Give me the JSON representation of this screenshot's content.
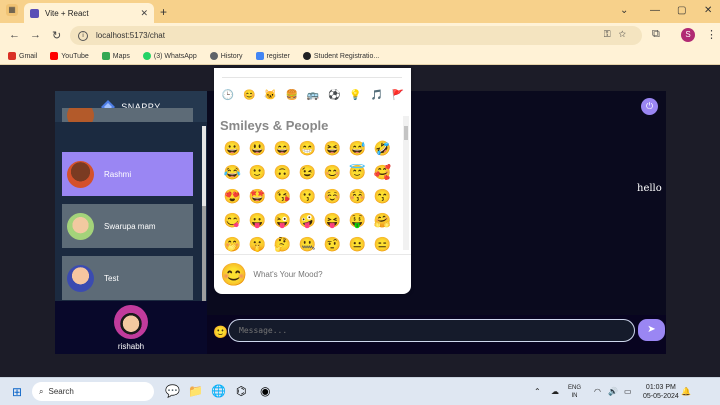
{
  "browser": {
    "tab_title": "Vite + React",
    "tab_close": "✕",
    "new_tab": "+",
    "window_controls": [
      "⌄",
      "—",
      "▢",
      "✕"
    ],
    "nav": {
      "back": "←",
      "forward": "→",
      "reload": "↻"
    },
    "url": "localhost:5173/chat",
    "omnibox_icons": "⚿☆",
    "profile_initial": "S",
    "bookmarks": [
      {
        "label": "Gmail",
        "color": "#d93025"
      },
      {
        "label": "YouTube",
        "color": "#ff0000"
      },
      {
        "label": "Maps",
        "color": "#34a853"
      },
      {
        "label": "(3) WhatsApp",
        "color": "#25d366"
      },
      {
        "label": "History",
        "color": "#5f6368"
      },
      {
        "label": "register",
        "color": "#4285f4"
      },
      {
        "label": "Student Registratio...",
        "color": "#202124"
      }
    ]
  },
  "app": {
    "brand": "SNAPPY",
    "accent": "#9a86f3",
    "contacts": [
      {
        "name": "Rashmi",
        "selected": true
      },
      {
        "name": "Swarupa mam",
        "selected": false
      },
      {
        "name": "Test",
        "selected": false
      }
    ],
    "current_user": "rishabh",
    "messages": [
      {
        "text": "hello",
        "side": "received"
      }
    ],
    "message_placeholder": "Message...",
    "send_icon": "➤",
    "logout_icon": "⏻",
    "emoji_toggle": "🙂"
  },
  "emoji_picker": {
    "categories": [
      "🕒",
      "😊",
      "🐱",
      "🍔",
      "🚌",
      "⚽",
      "💡",
      "🎵",
      "🚩"
    ],
    "section_title": "Smileys & People",
    "emojis": [
      "😀",
      "😃",
      "😄",
      "😁",
      "😆",
      "😅",
      "🤣",
      "😂",
      "🙂",
      "🙃",
      "😉",
      "😊",
      "😇",
      "🥰",
      "😍",
      "🤩",
      "😘",
      "😗",
      "☺️",
      "😚",
      "😙",
      "😋",
      "😛",
      "😜",
      "🤪",
      "😝",
      "🤑",
      "🤗",
      "🤭",
      "🤫",
      "🤔",
      "🤐",
      "🤨",
      "😐",
      "😑"
    ],
    "preview_emoji": "😊",
    "preview_text": "What's Your Mood?"
  },
  "taskbar": {
    "start_icon": "⊞",
    "search_label": "Search",
    "tray": {
      "lang_line1": "ENG",
      "lang_line2": "IN",
      "time": "01:03 PM",
      "date": "05-05-2024"
    }
  }
}
